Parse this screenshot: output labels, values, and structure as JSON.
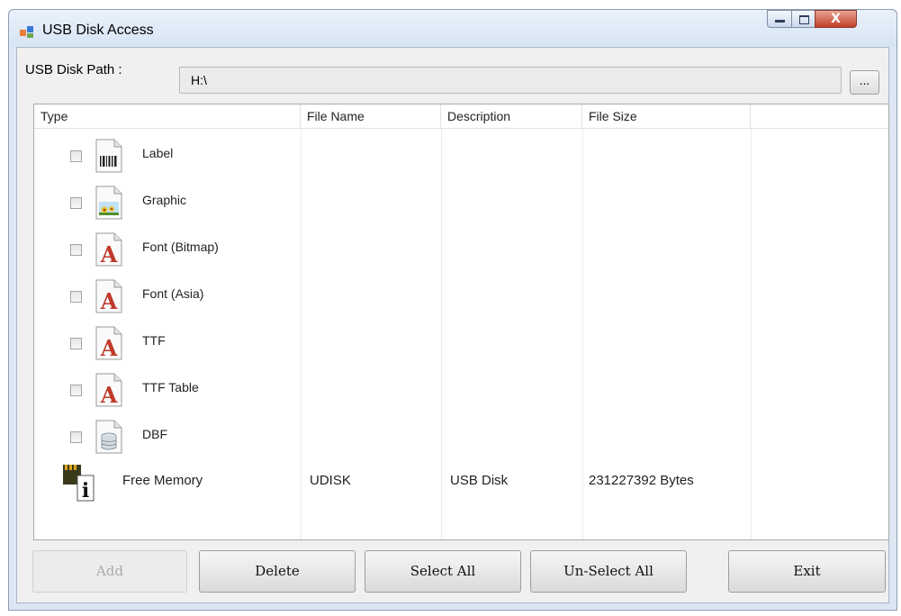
{
  "window": {
    "title": "USB Disk Access",
    "close_glyph": "X"
  },
  "path": {
    "label": "USB Disk Path :",
    "value": "H:\\",
    "browse_label": "..."
  },
  "columns": [
    "Type",
    "File Name",
    "Description",
    "File Size"
  ],
  "rows": [
    {
      "label": "Label",
      "icon": "label-file-icon",
      "checked": false
    },
    {
      "label": "Graphic",
      "icon": "graphic-file-icon",
      "checked": false
    },
    {
      "label": "Font (Bitmap)",
      "icon": "font-file-icon",
      "checked": false
    },
    {
      "label": "Font (Asia)",
      "icon": "font-file-icon",
      "checked": false
    },
    {
      "label": "TTF",
      "icon": "font-file-icon",
      "checked": false
    },
    {
      "label": "TTF Table",
      "icon": "font-file-icon",
      "checked": false
    },
    {
      "label": "DBF",
      "icon": "database-file-icon",
      "checked": false
    }
  ],
  "memory": {
    "label": "Free Memory",
    "file_name": "UDISK",
    "description": "USB Disk",
    "file_size": "231227392 Bytes",
    "icon": "memory-info-icon"
  },
  "buttons": {
    "add": "Add",
    "delete": "Delete",
    "select_all": "Select All",
    "unselect_all": "Un-Select All",
    "exit": "Exit"
  },
  "colors": {
    "titlebar": "#dce7f3",
    "close_button": "#c2412b",
    "font_icon_red": "#c0392b",
    "disabled_text": "#a9a9a9"
  }
}
